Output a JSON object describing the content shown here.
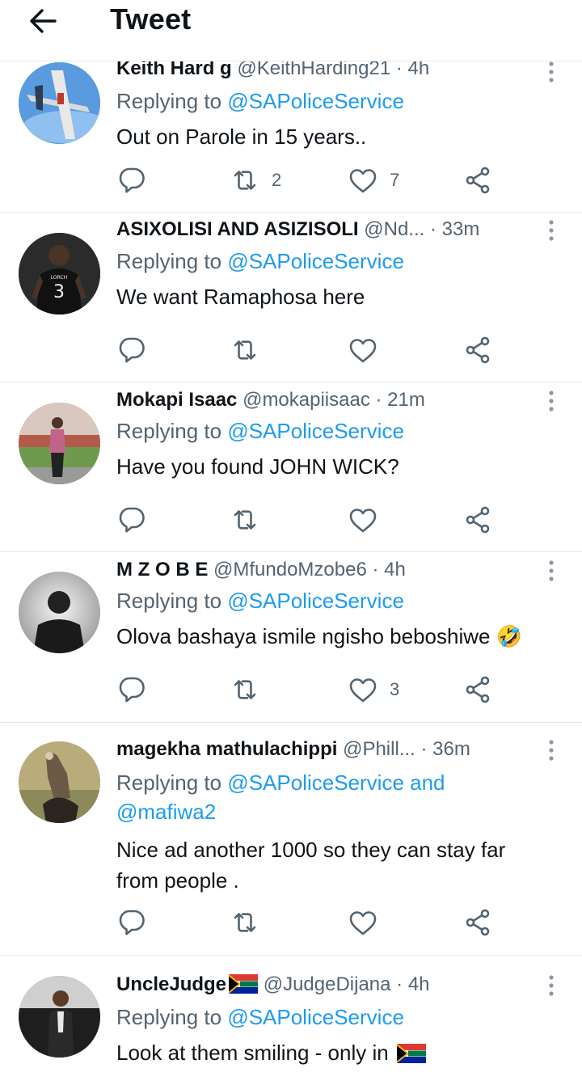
{
  "header": {
    "title": "Tweet"
  },
  "tweets": [
    {
      "name": "Keith Hard g",
      "handle": "@KeithHarding21",
      "time": "· 4h",
      "replying_prefix": "Replying to",
      "mention": "@SAPoliceService",
      "mention_extra_prefix": "",
      "mention_extra": "",
      "text": "Out on Parole in 15 years..",
      "retweets": "2",
      "likes": "7",
      "avatar": "airplane-avatar"
    },
    {
      "name": "ASIXOLISI AND ASIZISOLI",
      "handle": "@Nd...",
      "time": "· 33m",
      "replying_prefix": "Replying to",
      "mention": "@SAPoliceService",
      "mention_extra_prefix": "",
      "mention_extra": "",
      "text": "We want Ramaphosa here",
      "retweets": "",
      "likes": "",
      "avatar": "football-jersey-avatar"
    },
    {
      "name": "Mokapi Isaac",
      "handle": "@mokapiisaac",
      "time": "· 21m",
      "replying_prefix": "Replying to",
      "mention": "@SAPoliceService",
      "mention_extra_prefix": "",
      "mention_extra": "",
      "text": "Have you found JOHN WICK?",
      "retweets": "",
      "likes": "",
      "avatar": "person-standing-avatar"
    },
    {
      "name": "M Z O B E",
      "handle": "@MfundoMzobe6",
      "time": "· 4h",
      "replying_prefix": "Replying to",
      "mention": "@SAPoliceService",
      "mention_extra_prefix": "",
      "mention_extra": "",
      "text": "Olova bashaya ismile ngisho beboshiwe 🤣",
      "retweets": "",
      "likes": "3",
      "avatar": "portrait-avatar"
    },
    {
      "name": "magekha mathulachippi",
      "handle": "@Phill...",
      "time": "· 36m",
      "replying_prefix": "Replying to",
      "mention": "@SAPoliceService",
      "mention_extra_prefix": "and",
      "mention_extra": "@mafiwa2",
      "text": "Nice ad another 1000 so they can stay far from people .",
      "retweets": "",
      "likes": "",
      "avatar": "vulture-avatar"
    },
    {
      "name": "UncleJudge",
      "handle": "@JudgeDijana",
      "time": "· 4h",
      "replying_prefix": "Replying to",
      "mention": "@SAPoliceService",
      "mention_extra_prefix": "",
      "mention_extra": "",
      "text": "Look at them smiling - only in",
      "retweets": "",
      "likes": "",
      "avatar": "man-car-avatar"
    }
  ],
  "colors": {
    "link": "#1d9bf0",
    "secondary": "#536471",
    "text": "#0f1419",
    "divider": "#e1e8ed"
  },
  "icons": [
    "back-arrow-icon",
    "more-icon",
    "reply-icon",
    "retweet-icon",
    "like-icon",
    "share-icon",
    "south-africa-flag-icon",
    "laughing-emoji-icon"
  ]
}
